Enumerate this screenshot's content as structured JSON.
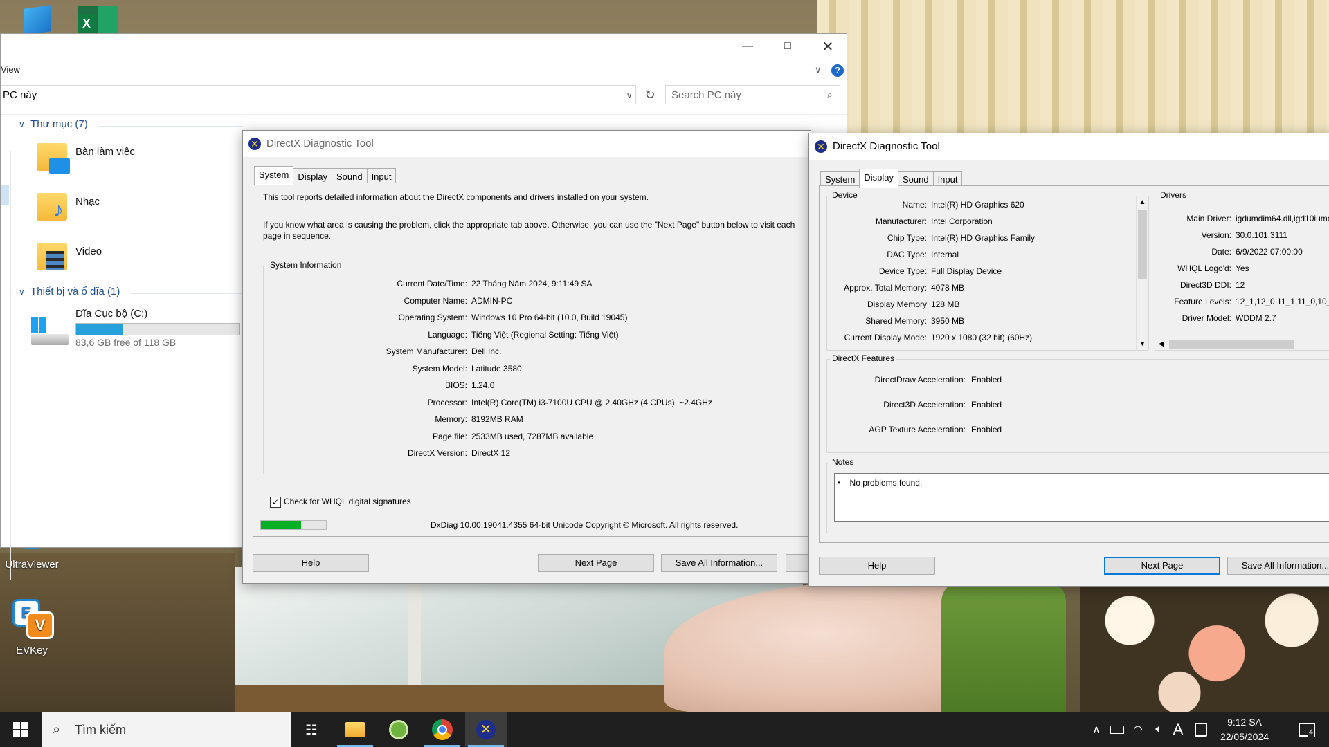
{
  "desktop": {
    "icons": [
      {
        "label": "UltraViewer"
      },
      {
        "label": "EVKey"
      }
    ]
  },
  "explorer": {
    "menu_view": "View",
    "address": "PC này",
    "search_placeholder": "Search PC này",
    "groups": [
      {
        "title": "Thư mục (7)"
      },
      {
        "title": "Thiết bị và ổ đĩa (1)"
      }
    ],
    "folders": [
      "Bàn làm việc",
      "Nhạc",
      "Video"
    ],
    "drive": {
      "name": "Đĩa Cục bộ (C:)",
      "free_text": "83,6 GB free of 118 GB",
      "used_fraction": 0.29
    }
  },
  "dx_left": {
    "title": "DirectX Diagnostic Tool",
    "tabs": [
      "System",
      "Display",
      "Sound",
      "Input"
    ],
    "selected_tab": "System",
    "intro1": "This tool reports detailed information about the DirectX components and drivers installed on your system.",
    "intro2": "If you know what area is causing the problem, click the appropriate tab above.  Otherwise, you can use the \"Next Page\" button below to visit each page in sequence.",
    "sysinfo_title": "System Information",
    "rows": [
      {
        "label": "Current Date/Time:",
        "value": "22 Tháng Năm 2024, 9:11:49 SA"
      },
      {
        "label": "Computer Name:",
        "value": "ADMIN-PC"
      },
      {
        "label": "Operating System:",
        "value": "Windows 10 Pro 64-bit (10.0, Build 19045)"
      },
      {
        "label": "Language:",
        "value": "Tiếng Việt (Regional Setting: Tiếng Việt)"
      },
      {
        "label": "System Manufacturer:",
        "value": "Dell Inc."
      },
      {
        "label": "System Model:",
        "value": "Latitude 3580"
      },
      {
        "label": "BIOS:",
        "value": "1.24.0"
      },
      {
        "label": "Processor:",
        "value": "Intel(R) Core(TM) i3-7100U CPU @ 2.40GHz (4 CPUs), ~2.4GHz"
      },
      {
        "label": "Memory:",
        "value": "8192MB RAM"
      },
      {
        "label": "Page file:",
        "value": "2533MB used, 7287MB available"
      },
      {
        "label": "DirectX Version:",
        "value": "DirectX 12"
      }
    ],
    "whql_label": "Check for WHQL digital signatures",
    "whql_checked": true,
    "progress_fraction": 0.62,
    "footer": "DxDiag 10.00.19041.4355 64-bit Unicode  Copyright © Microsoft. All rights reserved.",
    "buttons": {
      "help": "Help",
      "next": "Next Page",
      "save": "Save All Information..."
    }
  },
  "dx_right": {
    "title": "DirectX Diagnostic Tool",
    "tabs": [
      "System",
      "Display",
      "Sound",
      "Input"
    ],
    "selected_tab": "Display",
    "device_title": "Device",
    "device_rows": [
      {
        "label": "Name:",
        "value": "Intel(R) HD Graphics 620"
      },
      {
        "label": "Manufacturer:",
        "value": "Intel Corporation"
      },
      {
        "label": "Chip Type:",
        "value": "Intel(R) HD Graphics Family"
      },
      {
        "label": "DAC Type:",
        "value": "Internal"
      },
      {
        "label": "Device Type:",
        "value": "Full Display Device"
      },
      {
        "label": "Approx. Total Memory:",
        "value": "4078 MB"
      },
      {
        "label": "Display Memory",
        "value": "128 MB"
      },
      {
        "label": "Shared Memory:",
        "value": "3950 MB"
      },
      {
        "label": "Current Display Mode:",
        "value": "1920 x 1080 (32 bit) (60Hz)"
      }
    ],
    "drivers_title": "Drivers",
    "driver_rows": [
      {
        "label": "Main Driver:",
        "value": "igdumdim64.dll,igd10iumd"
      },
      {
        "label": "Version:",
        "value": "30.0.101.3111"
      },
      {
        "label": "Date:",
        "value": "6/9/2022 07:00:00"
      },
      {
        "label": "WHQL Logo'd:",
        "value": "Yes"
      },
      {
        "label": "Direct3D DDI:",
        "value": "12"
      },
      {
        "label": "Feature Levels:",
        "value": "12_1,12_0,11_1,11_0,10_"
      },
      {
        "label": "Driver Model:",
        "value": "WDDM 2.7"
      }
    ],
    "features_title": "DirectX Features",
    "feature_rows": [
      {
        "label": "DirectDraw Acceleration:",
        "value": "Enabled"
      },
      {
        "label": "Direct3D Acceleration:",
        "value": "Enabled"
      },
      {
        "label": "AGP Texture Acceleration:",
        "value": "Enabled"
      }
    ],
    "notes_title": "Notes",
    "notes": [
      "No problems found."
    ],
    "buttons": {
      "help": "Help",
      "next": "Next Page",
      "save": "Save All Information..."
    }
  },
  "taskbar": {
    "search_placeholder": "Tìm kiếm",
    "time": "9:12 SA",
    "date": "22/05/2024",
    "notification_count": "4",
    "ime_letter": "A"
  },
  "colors": {
    "accent": "#0078d7",
    "progress": "#06b025",
    "drive_bar": "#26a0da",
    "taskbar": "#1f1f1f",
    "explorer_group": "#1f4e8f"
  }
}
